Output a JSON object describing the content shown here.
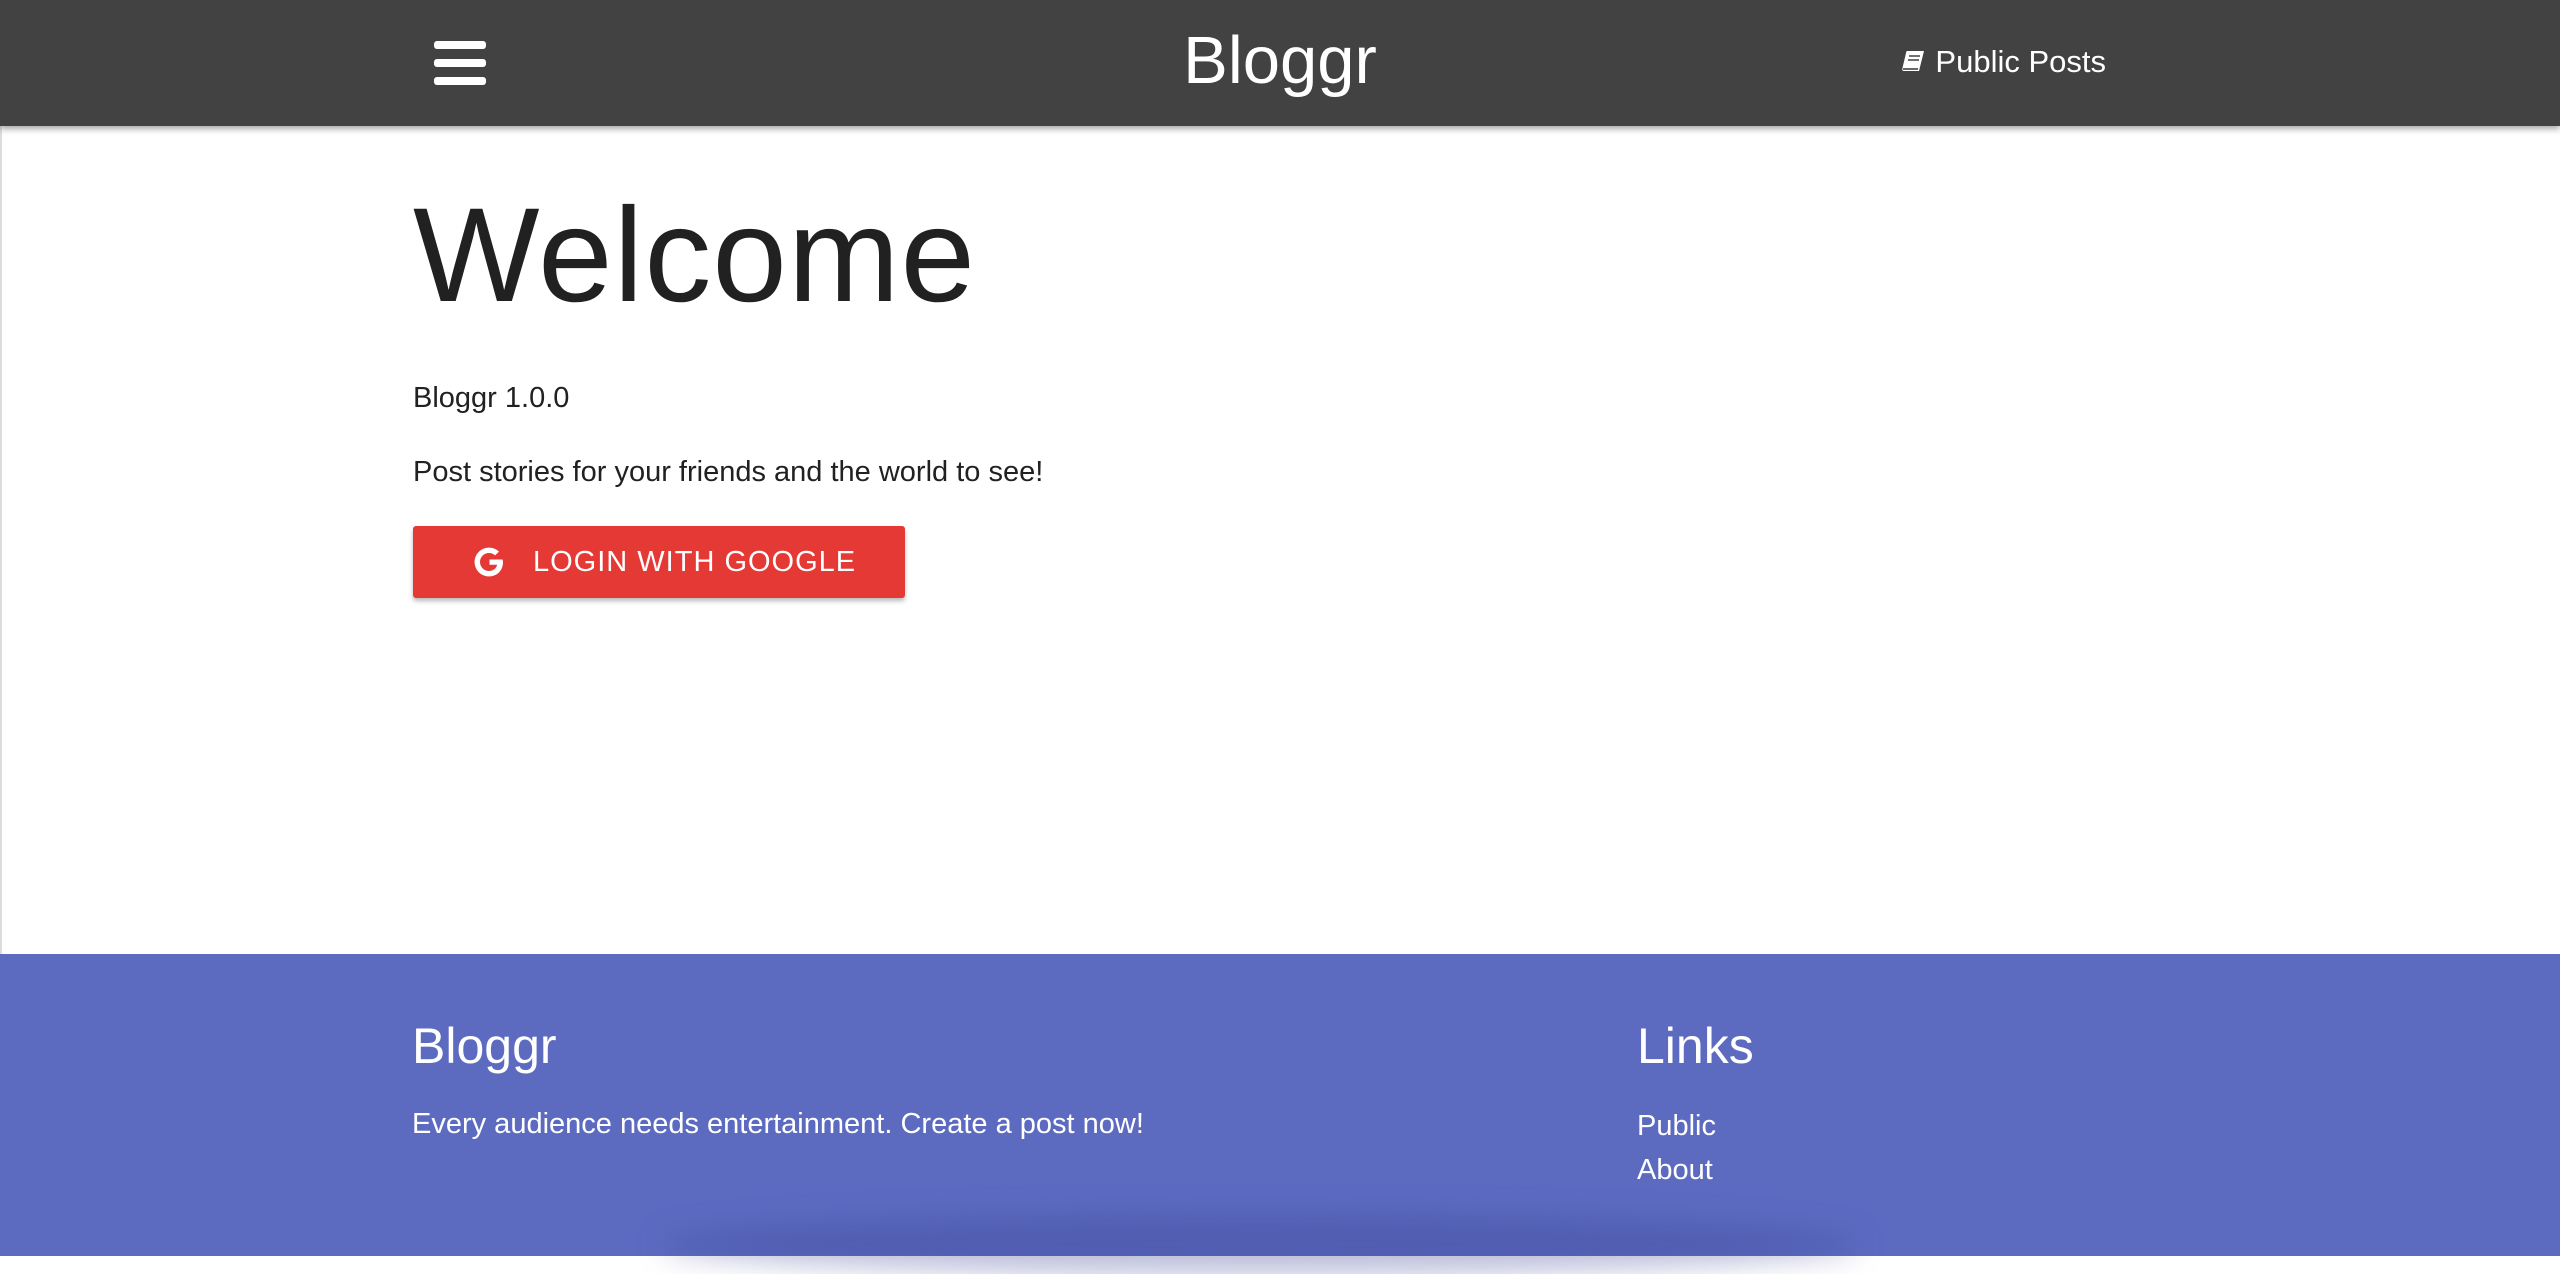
{
  "navbar": {
    "menu_icon": "hamburger-menu-icon",
    "brand": "Bloggr",
    "public_posts_icon": "book-icon",
    "public_posts_label": "Public Posts"
  },
  "main": {
    "heading": "Welcome",
    "version": "Bloggr 1.0.0",
    "tagline": "Post stories for your friends and the world to see!",
    "login_button": {
      "icon": "google-icon",
      "label": "LOGIN WITH GOOGLE"
    }
  },
  "footer": {
    "title": "Bloggr",
    "text": "Every audience needs entertainment. Create a post now!",
    "links_title": "Links",
    "links": [
      {
        "label": "Public"
      },
      {
        "label": "About"
      }
    ]
  },
  "colors": {
    "navbar_bg": "#424242",
    "login_button_bg": "#e53935",
    "footer_bg": "#5c6bc0",
    "text": "#212121"
  }
}
